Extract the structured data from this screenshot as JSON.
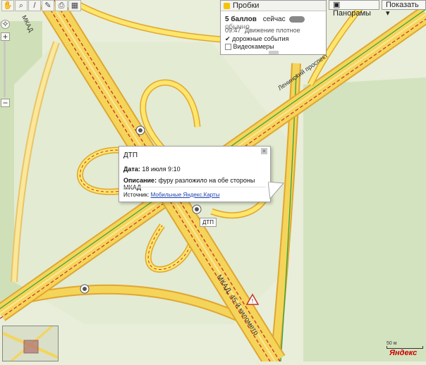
{
  "toolbar": {
    "icons": [
      "hand-icon",
      "magnifier-icon",
      "ruler-icon",
      "sticker-icon",
      "print-icon"
    ]
  },
  "traffic_panel": {
    "header": "Пробки",
    "score": "5 баллов",
    "mode_now": "сейчас",
    "mode_usual": "обычно",
    "time": "09:47",
    "status": "Движение плотное",
    "options": [
      {
        "label": "дорожные события",
        "checked": true
      },
      {
        "label": "Видеокамеры",
        "checked": false
      }
    ]
  },
  "top_buttons": {
    "panoramas": "Панорамы",
    "show": "Показать"
  },
  "popup": {
    "title": "ДТП",
    "date_label": "Дата:",
    "date_value": "18 июля 9:10",
    "desc_label": "Описание:",
    "desc_value": "фуру разложило на обе стороны МКАД",
    "source_label": "Источник:",
    "source_link": "Мобильные Яндекс.Карты",
    "close": "×"
  },
  "marker_tag": "ДТП",
  "road_labels": {
    "mkad": "МКАД, 45-й километр",
    "leninsky": "Ленинский проспект",
    "top_left": "МКАД"
  },
  "scale": "50 м",
  "logo": "Яндекс",
  "colors": {
    "background": "#e8eed9",
    "road_fill": "#f5d45a",
    "road_edge": "#e0a630",
    "traffic_red": "#c8322a",
    "traffic_green": "#2fa43a",
    "ramp_fill": "#fde66b"
  }
}
